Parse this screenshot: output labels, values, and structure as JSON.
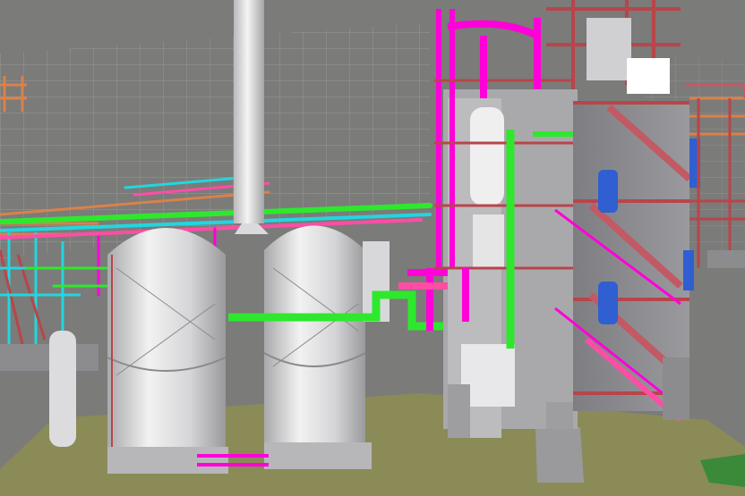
{
  "scene": {
    "kind": "3d-plant-model-render",
    "colors": {
      "background": "#7d7d7b",
      "grid_lines": "#b4b4b2",
      "ground_slab": "#8a8a5a",
      "concrete": "#8c8c8e",
      "tank": "#dcdcde",
      "pipe_magenta": "#ff00d8",
      "pipe_pink": "#ff4da6",
      "pipe_green": "#2ee82e",
      "pipe_cyan": "#22d6e0",
      "steel_red": "#b8454b",
      "steel_orange": "#d9824a",
      "vessel_blue": "#2f5fd0",
      "grass_green": "#3a8a3a"
    }
  }
}
